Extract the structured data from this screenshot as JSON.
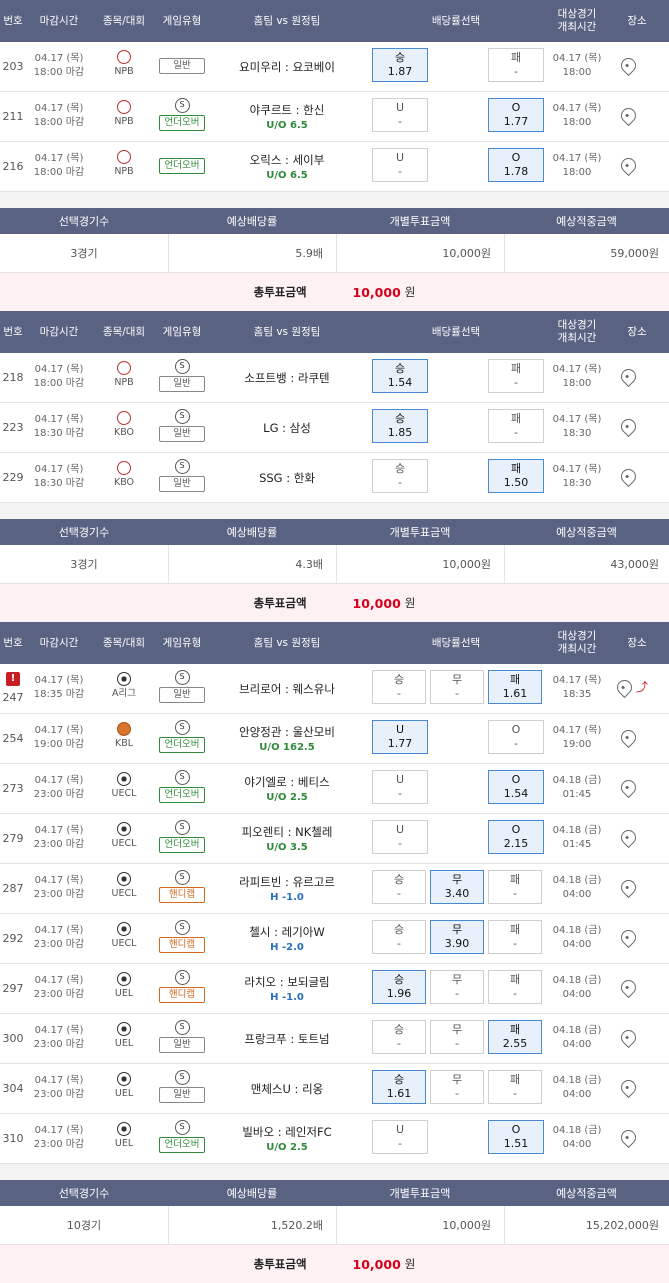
{
  "header": {
    "no": "번호",
    "deadline": "마감시간",
    "sport": "종목/대회",
    "game_type": "게임유형",
    "teams": "홈팀 vs 원정팀",
    "odds": "배당률선택",
    "event_time_1": "대상경기",
    "event_time_2": "개최시간",
    "place": "장소"
  },
  "summary_header": {
    "count": "선택경기수",
    "odds": "예상배당률",
    "stake": "개별투표금액",
    "payout": "예상적중금액"
  },
  "total_label": "총투표금액",
  "total_unit": "원",
  "badges": {
    "normal": "일반",
    "ou": "언더오버",
    "hc": "핸디캡"
  },
  "s_mark": "S",
  "sections": [
    {
      "rows": [
        {
          "no": "203",
          "date": "04.17 (목)",
          "dl": "18:00 마감",
          "league": "NPB",
          "sport": "baseball",
          "s": false,
          "type": "normal",
          "match": "요미우리 : 요코베이",
          "line": "",
          "odds": [
            {
              "l": "승",
              "v": "1.87",
              "sel": true
            },
            {
              "l": "패",
              "v": "-",
              "sel": false
            }
          ],
          "ed": "04.17 (목)",
          "et": "18:00"
        },
        {
          "no": "211",
          "date": "04.17 (목)",
          "dl": "18:00 마감",
          "league": "NPB",
          "sport": "baseball",
          "s": true,
          "type": "ou",
          "match": "야쿠르트 : 한신",
          "line": "U/O 6.5",
          "odds": [
            {
              "l": "U",
              "v": "-",
              "sel": false
            },
            {
              "l": "O",
              "v": "1.77",
              "sel": true
            }
          ],
          "ed": "04.17 (목)",
          "et": "18:00"
        },
        {
          "no": "216",
          "date": "04.17 (목)",
          "dl": "18:00 마감",
          "league": "NPB",
          "sport": "baseball",
          "s": false,
          "type": "ou",
          "match": "오릭스 : 세이부",
          "line": "U/O 6.5",
          "odds": [
            {
              "l": "U",
              "v": "-",
              "sel": false
            },
            {
              "l": "O",
              "v": "1.78",
              "sel": true
            }
          ],
          "ed": "04.17 (목)",
          "et": "18:00"
        }
      ],
      "summary": {
        "count": "3경기",
        "odds": "5.9배",
        "stake": "10,000원",
        "payout": "59,000원"
      },
      "total": "10,000"
    },
    {
      "rows": [
        {
          "no": "218",
          "date": "04.17 (목)",
          "dl": "18:00 마감",
          "league": "NPB",
          "sport": "baseball",
          "s": true,
          "type": "normal",
          "match": "소프트뱅 : 라쿠텐",
          "line": "",
          "odds": [
            {
              "l": "승",
              "v": "1.54",
              "sel": true
            },
            {
              "l": "패",
              "v": "-",
              "sel": false
            }
          ],
          "ed": "04.17 (목)",
          "et": "18:00"
        },
        {
          "no": "223",
          "date": "04.17 (목)",
          "dl": "18:30 마감",
          "league": "KBO",
          "sport": "baseball",
          "s": true,
          "type": "normal",
          "match": "LG : 삼성",
          "line": "",
          "odds": [
            {
              "l": "승",
              "v": "1.85",
              "sel": true
            },
            {
              "l": "패",
              "v": "-",
              "sel": false
            }
          ],
          "ed": "04.17 (목)",
          "et": "18:30"
        },
        {
          "no": "229",
          "date": "04.17 (목)",
          "dl": "18:30 마감",
          "league": "KBO",
          "sport": "baseball",
          "s": true,
          "type": "normal",
          "match": "SSG : 한화",
          "line": "",
          "odds": [
            {
              "l": "승",
              "v": "-",
              "sel": false
            },
            {
              "l": "패",
              "v": "1.50",
              "sel": true
            }
          ],
          "ed": "04.17 (목)",
          "et": "18:30"
        }
      ],
      "summary": {
        "count": "3경기",
        "odds": "4.3배",
        "stake": "10,000원",
        "payout": "43,000원"
      },
      "total": "10,000"
    },
    {
      "rows": [
        {
          "no": "247",
          "alert": "!",
          "date": "04.17 (목)",
          "dl": "18:35 마감",
          "league": "A리그",
          "sport": "soccer",
          "s": true,
          "type": "normal",
          "match": "브리로어 : 웨스유나",
          "line": "",
          "odds3": [
            {
              "l": "승",
              "v": "-",
              "sel": false
            },
            {
              "l": "무",
              "v": "-",
              "sel": false
            },
            {
              "l": "패",
              "v": "1.61",
              "sel": true
            }
          ],
          "ed": "04.17 (목)",
          "et": "18:35",
          "trend": true
        },
        {
          "no": "254",
          "date": "04.17 (목)",
          "dl": "19:00 마감",
          "league": "KBL",
          "sport": "basket",
          "s": true,
          "type": "ou",
          "match": "안양정관 : 울산모비",
          "line": "U/O 162.5",
          "odds": [
            {
              "l": "U",
              "v": "1.77",
              "sel": true
            },
            {
              "l": "O",
              "v": "-",
              "sel": false
            }
          ],
          "ed": "04.17 (목)",
          "et": "19:00"
        },
        {
          "no": "273",
          "date": "04.17 (목)",
          "dl": "23:00 마감",
          "league": "UECL",
          "sport": "soccer",
          "s": true,
          "type": "ou",
          "match": "야기엘로 : 베티스",
          "line": "U/O 2.5",
          "odds": [
            {
              "l": "U",
              "v": "-",
              "sel": false
            },
            {
              "l": "O",
              "v": "1.54",
              "sel": true
            }
          ],
          "ed": "04.18 (금)",
          "et": "01:45"
        },
        {
          "no": "279",
          "date": "04.17 (목)",
          "dl": "23:00 마감",
          "league": "UECL",
          "sport": "soccer",
          "s": true,
          "type": "ou",
          "match": "피오렌티 : NK첼레",
          "line": "U/O 3.5",
          "odds": [
            {
              "l": "U",
              "v": "-",
              "sel": false
            },
            {
              "l": "O",
              "v": "2.15",
              "sel": true
            }
          ],
          "ed": "04.18 (금)",
          "et": "01:45"
        },
        {
          "no": "287",
          "date": "04.17 (목)",
          "dl": "23:00 마감",
          "league": "UECL",
          "sport": "soccer",
          "s": true,
          "type": "hc",
          "match": "라피트빈 : 유르고르",
          "line": "H -1.0",
          "odds3": [
            {
              "l": "승",
              "v": "-",
              "sel": false
            },
            {
              "l": "무",
              "v": "3.40",
              "sel": true
            },
            {
              "l": "패",
              "v": "-",
              "sel": false
            }
          ],
          "ed": "04.18 (금)",
          "et": "04:00"
        },
        {
          "no": "292",
          "date": "04.17 (목)",
          "dl": "23:00 마감",
          "league": "UECL",
          "sport": "soccer",
          "s": true,
          "type": "hc",
          "match": "첼시 : 레기아W",
          "line": "H -2.0",
          "odds3": [
            {
              "l": "승",
              "v": "-",
              "sel": false
            },
            {
              "l": "무",
              "v": "3.90",
              "sel": true
            },
            {
              "l": "패",
              "v": "-",
              "sel": false
            }
          ],
          "ed": "04.18 (금)",
          "et": "04:00"
        },
        {
          "no": "297",
          "date": "04.17 (목)",
          "dl": "23:00 마감",
          "league": "UEL",
          "sport": "soccer",
          "s": true,
          "type": "hc",
          "match": "라치오 : 보되글림",
          "line": "H -1.0",
          "odds3": [
            {
              "l": "승",
              "v": "1.96",
              "sel": true
            },
            {
              "l": "무",
              "v": "-",
              "sel": false
            },
            {
              "l": "패",
              "v": "-",
              "sel": false
            }
          ],
          "ed": "04.18 (금)",
          "et": "04:00"
        },
        {
          "no": "300",
          "date": "04.17 (목)",
          "dl": "23:00 마감",
          "league": "UEL",
          "sport": "soccer",
          "s": true,
          "type": "normal",
          "match": "프랑크푸 : 토트넘",
          "line": "",
          "odds3": [
            {
              "l": "승",
              "v": "-",
              "sel": false
            },
            {
              "l": "무",
              "v": "-",
              "sel": false
            },
            {
              "l": "패",
              "v": "2.55",
              "sel": true
            }
          ],
          "ed": "04.18 (금)",
          "et": "04:00"
        },
        {
          "no": "304",
          "date": "04.17 (목)",
          "dl": "23:00 마감",
          "league": "UEL",
          "sport": "soccer",
          "s": true,
          "type": "normal",
          "match": "맨체스U : 리옹",
          "line": "",
          "odds3": [
            {
              "l": "승",
              "v": "1.61",
              "sel": true
            },
            {
              "l": "무",
              "v": "-",
              "sel": false
            },
            {
              "l": "패",
              "v": "-",
              "sel": false
            }
          ],
          "ed": "04.18 (금)",
          "et": "04:00"
        },
        {
          "no": "310",
          "date": "04.17 (목)",
          "dl": "23:00 마감",
          "league": "UEL",
          "sport": "soccer",
          "s": true,
          "type": "ou",
          "match": "빌바오 : 레인저FC",
          "line": "U/O 2.5",
          "odds": [
            {
              "l": "U",
              "v": "-",
              "sel": false
            },
            {
              "l": "O",
              "v": "1.51",
              "sel": true
            }
          ],
          "ed": "04.18 (금)",
          "et": "04:00"
        }
      ],
      "summary": {
        "count": "10경기",
        "odds": "1,520.2배",
        "stake": "10,000원",
        "payout": "15,202,000원"
      },
      "total": "10,000"
    }
  ]
}
